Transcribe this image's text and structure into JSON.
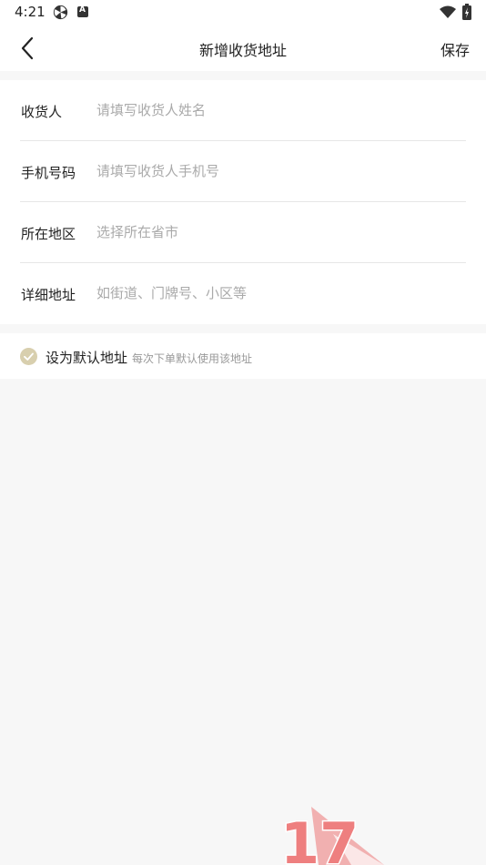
{
  "status_bar": {
    "time": "4:21",
    "icons": [
      "pinwheel-icon",
      "a-badge-icon",
      "wifi-icon",
      "battery-charging-icon"
    ]
  },
  "nav": {
    "back_icon": "chevron-left-icon",
    "title": "新增收货地址",
    "save_label": "保存"
  },
  "form": {
    "fields": [
      {
        "label": "收货人",
        "placeholder": "请填写收货人姓名",
        "value": ""
      },
      {
        "label": "手机号码",
        "placeholder": "请填写收货人手机号",
        "value": ""
      },
      {
        "label": "所在地区",
        "placeholder": "选择所在省市",
        "value": ""
      },
      {
        "label": "详细地址",
        "placeholder": "如街道、门牌号、小区等",
        "value": ""
      }
    ]
  },
  "default_address": {
    "label": "设为默认地址",
    "hint": "每次下单默认使用该地址",
    "checked": true,
    "check_color": "#d8cfae"
  },
  "watermark": {
    "text": "17"
  }
}
